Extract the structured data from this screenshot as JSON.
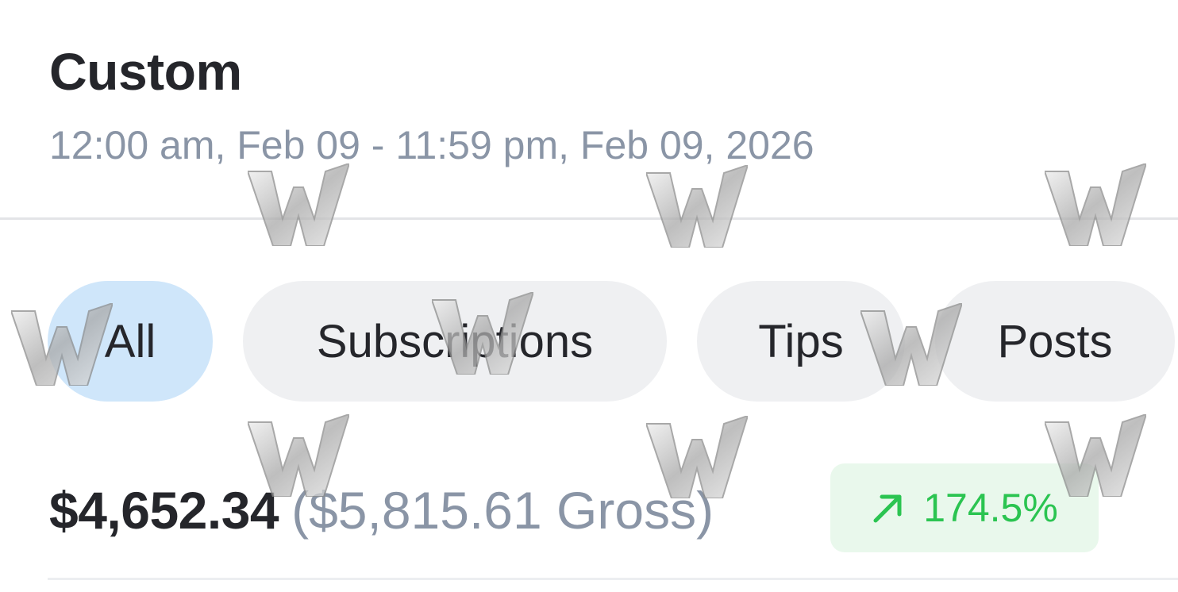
{
  "header": {
    "title": "Custom",
    "date_range": "12:00 am, Feb 09 - 11:59 pm, Feb 09, 2026"
  },
  "tabs": [
    {
      "label": "All",
      "active": true
    },
    {
      "label": "Subscriptions",
      "active": false
    },
    {
      "label": "Tips",
      "active": false
    },
    {
      "label": "Posts",
      "active": false
    }
  ],
  "summary": {
    "net_amount": "$4,652.34",
    "gross_amount": "($5,815.61 Gross)",
    "change_percent": "174.5%",
    "change_icon": "arrow-up-right-icon"
  },
  "colors": {
    "active_tab": "#cfe6fa",
    "inactive_tab": "#eff0f2",
    "positive_change": "#2bc451",
    "positive_change_bg": "#e9f8ec",
    "muted_text": "#8a95a6",
    "primary_text": "#25262b"
  },
  "watermark": {
    "icon": "w-watermark-icon"
  }
}
